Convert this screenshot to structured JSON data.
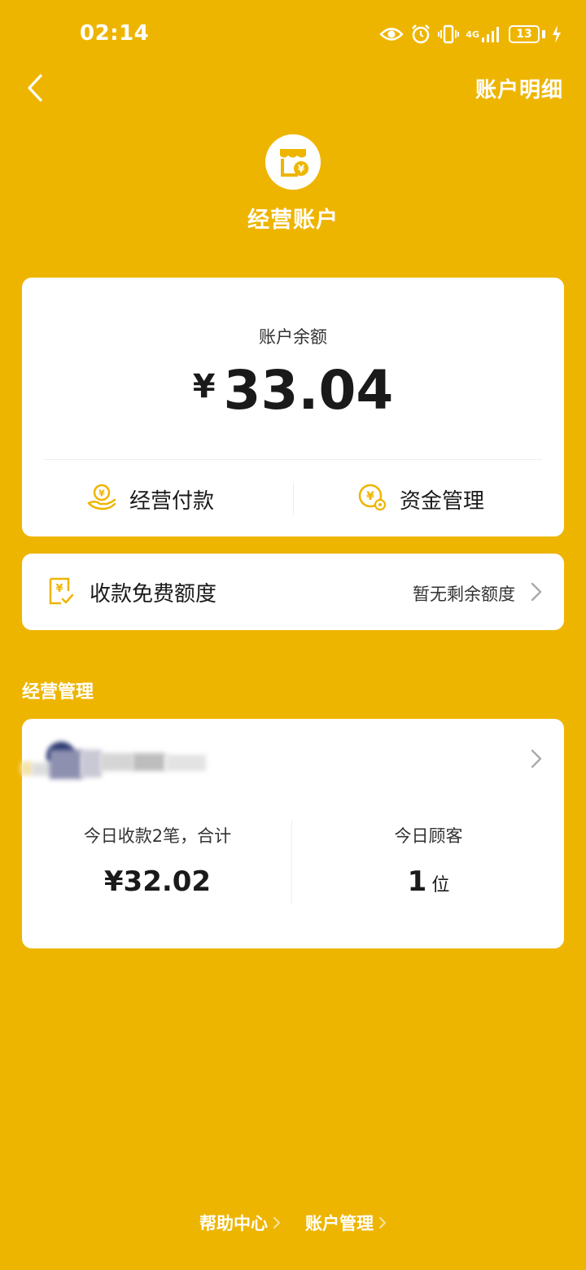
{
  "status_bar": {
    "time": "02:14",
    "network": "4G",
    "battery": "13",
    "icons": [
      "eye-icon",
      "alarm-icon",
      "vibrate-icon",
      "signal-icon",
      "battery-icon",
      "charging-icon"
    ]
  },
  "nav": {
    "back_icon": "chevron-left-icon",
    "right_link": "账户明细"
  },
  "header": {
    "icon": "shop-wallet-icon",
    "title": "经营账户"
  },
  "balance": {
    "label": "账户余额",
    "currency": "¥",
    "amount": "33.04",
    "actions": [
      {
        "label": "经营付款",
        "icon": "hand-coin-icon"
      },
      {
        "label": "资金管理",
        "icon": "coin-gear-icon"
      }
    ]
  },
  "quota": {
    "icon": "receipt-check-icon",
    "title": "收款免费额度",
    "status": "暂无剩余额度"
  },
  "section_title": "经营管理",
  "management": {
    "today_payments_label": "今日收款2笔，合计",
    "today_payments_amount": "¥32.02",
    "today_customers_label": "今日顾客",
    "today_customers_count": "1",
    "today_customers_unit": "位"
  },
  "footer": {
    "links": [
      "帮助中心",
      "账户管理"
    ]
  },
  "colors": {
    "background": "#EEB500",
    "accent": "#EEB500",
    "card": "#FFFFFF"
  }
}
